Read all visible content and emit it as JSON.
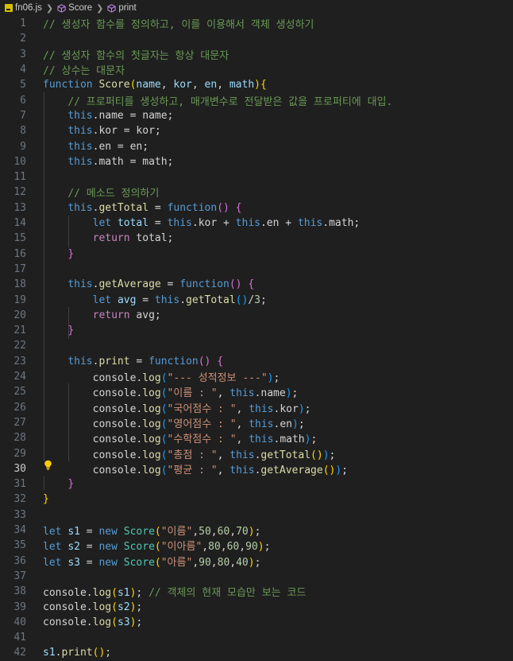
{
  "breadcrumb": {
    "file": "fn06.js",
    "symbol1": "Score",
    "symbol2": "print"
  },
  "editor": {
    "current_line": 30,
    "lines": [
      {
        "n": "1",
        "t": [
          [
            "com",
            "// 생성자 함수를 정의하고, 이를 이용해서 객체 생성하기"
          ]
        ]
      },
      {
        "n": "2",
        "t": []
      },
      {
        "n": "3",
        "t": [
          [
            "com",
            "// 생성자 함수의 첫글자는 항상 대문자"
          ]
        ]
      },
      {
        "n": "4",
        "t": [
          [
            "com",
            "// 상수는 대문자"
          ]
        ]
      },
      {
        "n": "5",
        "t": [
          [
            "kw",
            "function"
          ],
          [
            "",
            " "
          ],
          [
            "fn",
            "Score"
          ],
          [
            "p1",
            "("
          ],
          [
            "var",
            "name"
          ],
          [
            "",
            ", "
          ],
          [
            "var",
            "kor"
          ],
          [
            "",
            ", "
          ],
          [
            "var",
            "en"
          ],
          [
            "",
            ", "
          ],
          [
            "var",
            "math"
          ],
          [
            "p1",
            ")"
          ],
          [
            "p1",
            "{"
          ]
        ]
      },
      {
        "n": "6",
        "t": [
          [
            "",
            "    "
          ],
          [
            "com",
            "// 프로퍼티를 생성하고, 매개변수로 전달받은 값을 프로퍼티에 대입."
          ]
        ]
      },
      {
        "n": "7",
        "t": [
          [
            "",
            "    "
          ],
          [
            "kw",
            "this"
          ],
          [
            "",
            ".name = name;"
          ]
        ]
      },
      {
        "n": "8",
        "t": [
          [
            "",
            "    "
          ],
          [
            "kw",
            "this"
          ],
          [
            "",
            ".kor = kor;"
          ]
        ]
      },
      {
        "n": "9",
        "t": [
          [
            "",
            "    "
          ],
          [
            "kw",
            "this"
          ],
          [
            "",
            ".en = en;"
          ]
        ]
      },
      {
        "n": "10",
        "t": [
          [
            "",
            "    "
          ],
          [
            "kw",
            "this"
          ],
          [
            "",
            ".math = math;"
          ]
        ]
      },
      {
        "n": "11",
        "t": []
      },
      {
        "n": "12",
        "t": [
          [
            "",
            "    "
          ],
          [
            "com",
            "// 메소드 정의하기"
          ]
        ]
      },
      {
        "n": "13",
        "t": [
          [
            "",
            "    "
          ],
          [
            "kw",
            "this"
          ],
          [
            "",
            "."
          ],
          [
            "fn",
            "getTotal"
          ],
          [
            "",
            " = "
          ],
          [
            "kw",
            "function"
          ],
          [
            "p2",
            "()"
          ],
          [
            "",
            " "
          ],
          [
            "p2",
            "{"
          ]
        ]
      },
      {
        "n": "14",
        "t": [
          [
            "",
            "        "
          ],
          [
            "kw",
            "let"
          ],
          [
            "",
            " "
          ],
          [
            "var",
            "total"
          ],
          [
            "",
            " = "
          ],
          [
            "kw",
            "this"
          ],
          [
            "",
            ".kor + "
          ],
          [
            "kw",
            "this"
          ],
          [
            "",
            ".en + "
          ],
          [
            "kw",
            "this"
          ],
          [
            "",
            ".math;"
          ]
        ]
      },
      {
        "n": "15",
        "t": [
          [
            "",
            "        "
          ],
          [
            "ctl",
            "return"
          ],
          [
            "",
            " total;"
          ]
        ]
      },
      {
        "n": "16",
        "t": [
          [
            "",
            "    "
          ],
          [
            "p2",
            "}"
          ]
        ]
      },
      {
        "n": "17",
        "t": []
      },
      {
        "n": "18",
        "t": [
          [
            "",
            "    "
          ],
          [
            "kw",
            "this"
          ],
          [
            "",
            "."
          ],
          [
            "fn",
            "getAverage"
          ],
          [
            "",
            " = "
          ],
          [
            "kw",
            "function"
          ],
          [
            "p2",
            "()"
          ],
          [
            "",
            " "
          ],
          [
            "p2",
            "{"
          ]
        ]
      },
      {
        "n": "19",
        "t": [
          [
            "",
            "        "
          ],
          [
            "kw",
            "let"
          ],
          [
            "",
            " "
          ],
          [
            "var",
            "avg"
          ],
          [
            "",
            " = "
          ],
          [
            "kw",
            "this"
          ],
          [
            "",
            "."
          ],
          [
            "fn",
            "getTotal"
          ],
          [
            "p3",
            "()"
          ],
          [
            "",
            "/"
          ],
          [
            "num",
            "3"
          ],
          [
            "",
            ";"
          ]
        ]
      },
      {
        "n": "20",
        "t": [
          [
            "",
            "        "
          ],
          [
            "ctl",
            "return"
          ],
          [
            "",
            " avg;"
          ]
        ]
      },
      {
        "n": "21",
        "t": [
          [
            "",
            "    "
          ],
          [
            "p2",
            "}"
          ]
        ]
      },
      {
        "n": "22",
        "t": []
      },
      {
        "n": "23",
        "t": [
          [
            "",
            "    "
          ],
          [
            "kw",
            "this"
          ],
          [
            "",
            "."
          ],
          [
            "fn",
            "print"
          ],
          [
            "",
            " = "
          ],
          [
            "kw",
            "function"
          ],
          [
            "p2",
            "()"
          ],
          [
            "",
            " "
          ],
          [
            "p2",
            "{"
          ]
        ]
      },
      {
        "n": "24",
        "t": [
          [
            "",
            "        console."
          ],
          [
            "fn",
            "log"
          ],
          [
            "p3",
            "("
          ],
          [
            "str",
            "\"--- 성적정보 ---\""
          ],
          [
            "p3",
            ")"
          ],
          [
            "",
            ";"
          ]
        ]
      },
      {
        "n": "25",
        "t": [
          [
            "",
            "        console."
          ],
          [
            "fn",
            "log"
          ],
          [
            "p3",
            "("
          ],
          [
            "str",
            "\"이름 : \""
          ],
          [
            "",
            ", "
          ],
          [
            "kw",
            "this"
          ],
          [
            "",
            ".name"
          ],
          [
            "p3",
            ")"
          ],
          [
            "",
            ";"
          ]
        ]
      },
      {
        "n": "26",
        "t": [
          [
            "",
            "        console."
          ],
          [
            "fn",
            "log"
          ],
          [
            "p3",
            "("
          ],
          [
            "str",
            "\"국어점수 : \""
          ],
          [
            "",
            ", "
          ],
          [
            "kw",
            "this"
          ],
          [
            "",
            ".kor"
          ],
          [
            "p3",
            ")"
          ],
          [
            "",
            ";"
          ]
        ]
      },
      {
        "n": "27",
        "t": [
          [
            "",
            "        console."
          ],
          [
            "fn",
            "log"
          ],
          [
            "p3",
            "("
          ],
          [
            "str",
            "\"영어점수 : \""
          ],
          [
            "",
            ", "
          ],
          [
            "kw",
            "this"
          ],
          [
            "",
            ".en"
          ],
          [
            "p3",
            ")"
          ],
          [
            "",
            ";"
          ]
        ]
      },
      {
        "n": "28",
        "t": [
          [
            "",
            "        console."
          ],
          [
            "fn",
            "log"
          ],
          [
            "p3",
            "("
          ],
          [
            "str",
            "\"수학점수 : \""
          ],
          [
            "",
            ", "
          ],
          [
            "kw",
            "this"
          ],
          [
            "",
            ".math"
          ],
          [
            "p3",
            ")"
          ],
          [
            "",
            ";"
          ]
        ]
      },
      {
        "n": "29",
        "t": [
          [
            "",
            "        console."
          ],
          [
            "fn",
            "log"
          ],
          [
            "p3",
            "("
          ],
          [
            "str",
            "\"총점 : \""
          ],
          [
            "",
            ", "
          ],
          [
            "kw",
            "this"
          ],
          [
            "",
            "."
          ],
          [
            "fn",
            "getTotal"
          ],
          [
            "p1",
            "()"
          ],
          [
            "p3",
            ")"
          ],
          [
            "",
            ";"
          ]
        ]
      },
      {
        "n": "30",
        "t": [
          [
            "",
            "        console."
          ],
          [
            "fn",
            "log"
          ],
          [
            "p3",
            "("
          ],
          [
            "str",
            "\"평균 : \""
          ],
          [
            "",
            ", "
          ],
          [
            "kw",
            "this"
          ],
          [
            "",
            "."
          ],
          [
            "fn",
            "getAverage"
          ],
          [
            "p1",
            "()"
          ],
          [
            "p3",
            ")"
          ],
          [
            "",
            ";"
          ]
        ]
      },
      {
        "n": "31",
        "t": [
          [
            "",
            "    "
          ],
          [
            "p2",
            "}"
          ]
        ]
      },
      {
        "n": "32",
        "t": [
          [
            "p1",
            "}"
          ]
        ]
      },
      {
        "n": "33",
        "t": []
      },
      {
        "n": "34",
        "t": [
          [
            "kw",
            "let"
          ],
          [
            "",
            " "
          ],
          [
            "var",
            "s1"
          ],
          [
            "",
            " = "
          ],
          [
            "kw",
            "new"
          ],
          [
            "",
            " "
          ],
          [
            "cls",
            "Score"
          ],
          [
            "p1",
            "("
          ],
          [
            "str",
            "\"이름\""
          ],
          [
            "",
            ","
          ],
          [
            "num",
            "50"
          ],
          [
            "",
            ","
          ],
          [
            "num",
            "60"
          ],
          [
            "",
            ","
          ],
          [
            "num",
            "70"
          ],
          [
            "p1",
            ")"
          ],
          [
            "",
            ";"
          ]
        ]
      },
      {
        "n": "35",
        "t": [
          [
            "kw",
            "let"
          ],
          [
            "",
            " "
          ],
          [
            "var",
            "s2"
          ],
          [
            "",
            " = "
          ],
          [
            "kw",
            "new"
          ],
          [
            "",
            " "
          ],
          [
            "cls",
            "Score"
          ],
          [
            "p1",
            "("
          ],
          [
            "str",
            "\"이아름\""
          ],
          [
            "",
            ","
          ],
          [
            "num",
            "80"
          ],
          [
            "",
            ","
          ],
          [
            "num",
            "60"
          ],
          [
            "",
            ","
          ],
          [
            "num",
            "90"
          ],
          [
            "p1",
            ")"
          ],
          [
            "",
            ";"
          ]
        ]
      },
      {
        "n": "36",
        "t": [
          [
            "kw",
            "let"
          ],
          [
            "",
            " "
          ],
          [
            "var",
            "s3"
          ],
          [
            "",
            " = "
          ],
          [
            "kw",
            "new"
          ],
          [
            "",
            " "
          ],
          [
            "cls",
            "Score"
          ],
          [
            "p1",
            "("
          ],
          [
            "str",
            "\"아름\""
          ],
          [
            "",
            ","
          ],
          [
            "num",
            "90"
          ],
          [
            "",
            ","
          ],
          [
            "num",
            "80"
          ],
          [
            "",
            ","
          ],
          [
            "num",
            "40"
          ],
          [
            "p1",
            ")"
          ],
          [
            "",
            ";"
          ]
        ]
      },
      {
        "n": "37",
        "t": []
      },
      {
        "n": "38",
        "t": [
          [
            "",
            "console."
          ],
          [
            "fn",
            "log"
          ],
          [
            "p1",
            "("
          ],
          [
            "var",
            "s1"
          ],
          [
            "p1",
            ")"
          ],
          [
            "",
            "; "
          ],
          [
            "com",
            "// 객체의 현재 모습만 보는 코드"
          ]
        ]
      },
      {
        "n": "39",
        "t": [
          [
            "",
            "console."
          ],
          [
            "fn",
            "log"
          ],
          [
            "p1",
            "("
          ],
          [
            "var",
            "s2"
          ],
          [
            "p1",
            ")"
          ],
          [
            "",
            ";"
          ]
        ]
      },
      {
        "n": "40",
        "t": [
          [
            "",
            "console."
          ],
          [
            "fn",
            "log"
          ],
          [
            "p1",
            "("
          ],
          [
            "var",
            "s3"
          ],
          [
            "p1",
            ")"
          ],
          [
            "",
            ";"
          ]
        ]
      },
      {
        "n": "41",
        "t": []
      },
      {
        "n": "42",
        "t": [
          [
            "var",
            "s1"
          ],
          [
            "",
            "."
          ],
          [
            "fn",
            "print"
          ],
          [
            "p1",
            "()"
          ],
          [
            "",
            ";"
          ]
        ]
      }
    ]
  },
  "colors": {
    "background": "#1f1f1f",
    "keyword": "#569cd6",
    "control": "#c586c0",
    "function": "#dcdcaa",
    "variable": "#9cdcfe",
    "class": "#4ec9b0",
    "string": "#ce9178",
    "number": "#b5cea8",
    "comment": "#6a9955"
  },
  "icons": {
    "file": "javascript-file-icon",
    "symbol": "cube-icon",
    "lightbulb": "lightbulb-icon"
  }
}
